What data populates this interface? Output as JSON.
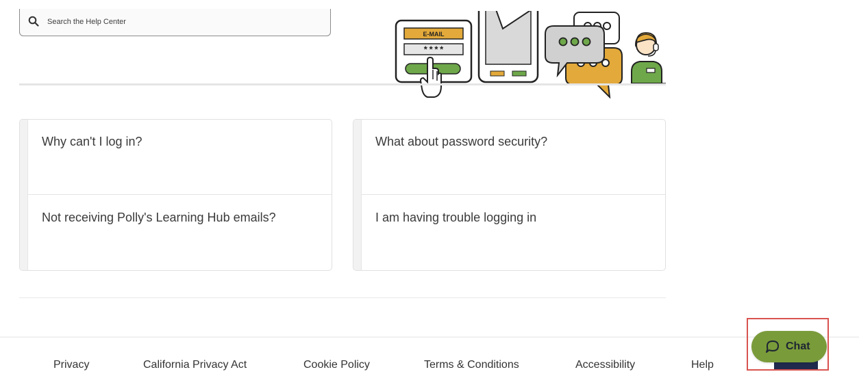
{
  "search": {
    "placeholder": "Search the Help Center",
    "icon": "search-icon"
  },
  "hero": {
    "illustration": {
      "icons": [
        "login-form-icon",
        "phone-icon",
        "chat-bubbles-icon",
        "support-agent-icon"
      ],
      "form_email_label": "E-MAIL",
      "form_password_mask": "****"
    }
  },
  "faq": {
    "cards": [
      {
        "items": [
          {
            "label": "Why can't I log in?"
          },
          {
            "label": "Not receiving Polly's Learning Hub emails?"
          }
        ]
      },
      {
        "items": [
          {
            "label": "What about password security?"
          },
          {
            "label": "I am having trouble logging in"
          }
        ]
      }
    ]
  },
  "footer": {
    "links": [
      {
        "label": "Privacy"
      },
      {
        "label": "California Privacy Act"
      },
      {
        "label": "Cookie Policy"
      },
      {
        "label": "Terms & Conditions"
      },
      {
        "label": "Accessibility"
      },
      {
        "label": "Help"
      }
    ]
  },
  "chat": {
    "label": "Chat",
    "icon": "chat-bubble-icon",
    "color": "#7a9b3a"
  },
  "colors": {
    "accent_green": "#7a9b3a",
    "illustration_yellow": "#e3a93a",
    "illustration_green": "#6ea84a",
    "highlight_red": "#d9534f"
  }
}
